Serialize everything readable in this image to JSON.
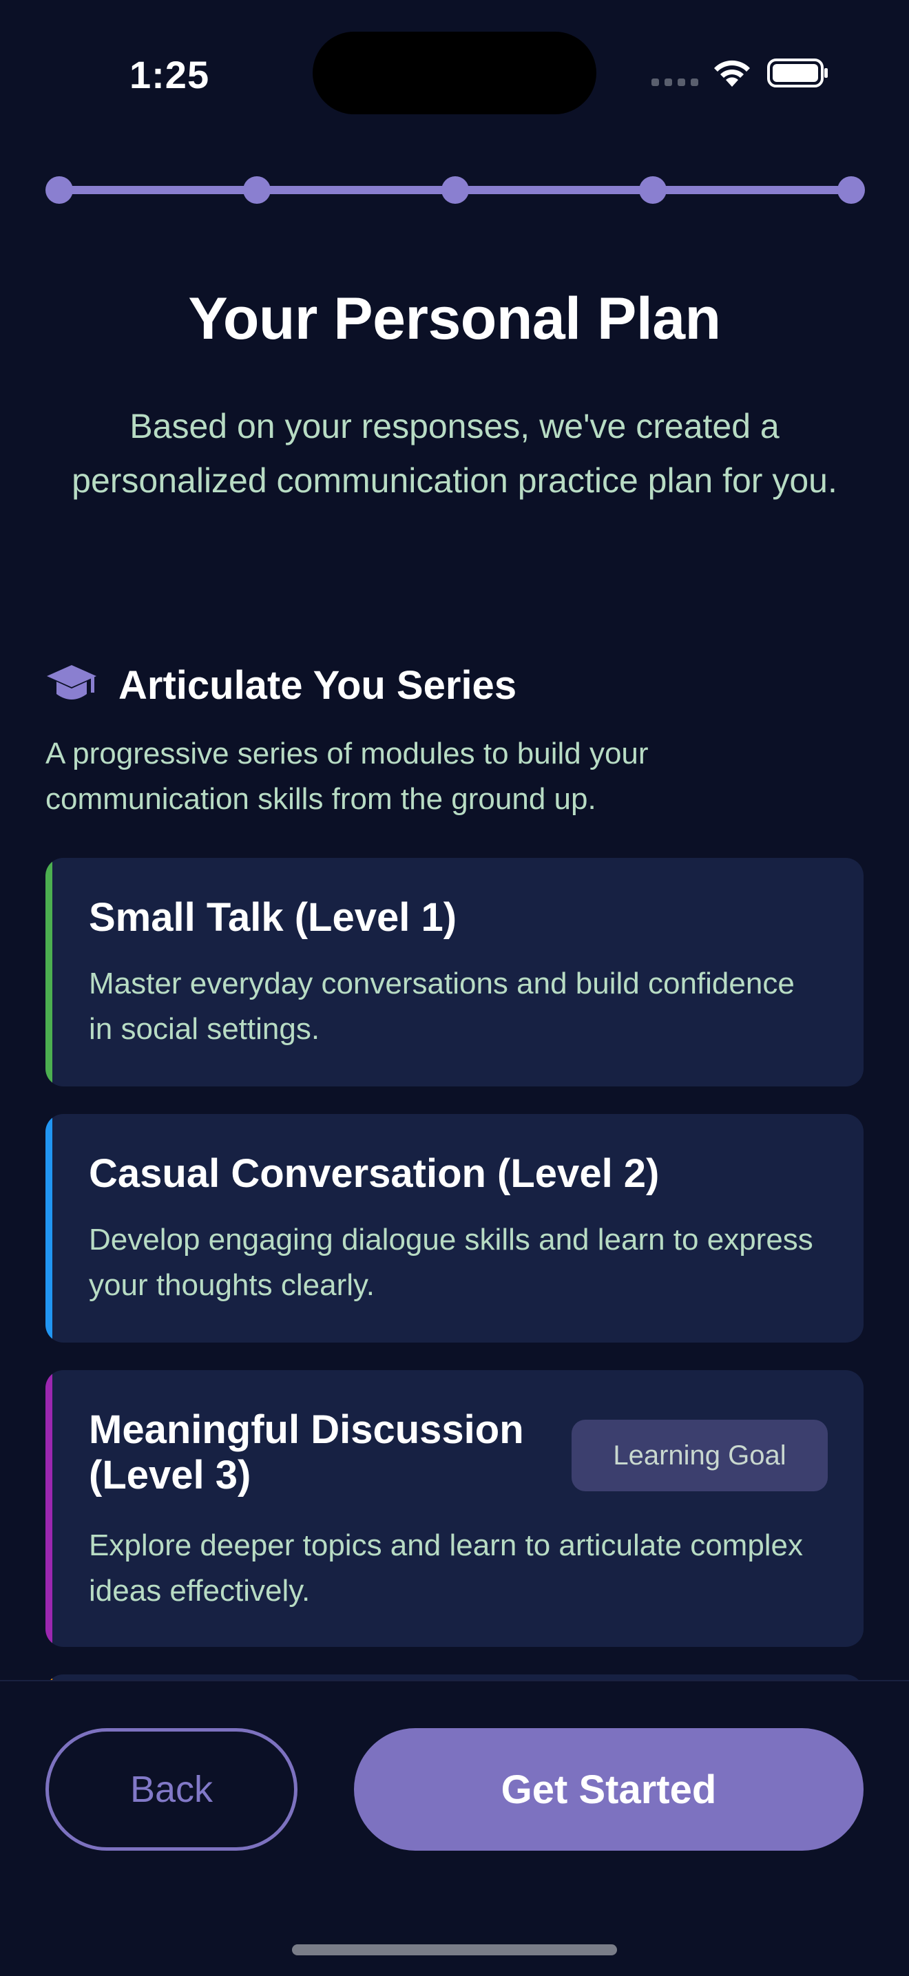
{
  "status_bar": {
    "time": "1:25"
  },
  "progress": {
    "steps": 5,
    "current_step": 5
  },
  "header": {
    "title": "Your Personal Plan",
    "subtitle": "Based on your responses, we've created a personalized communication practice plan for you."
  },
  "series": {
    "icon": "graduation-cap-icon",
    "title": "Articulate You Series",
    "description": "A progressive series of modules to build your communication skills from the ground up."
  },
  "modules": [
    {
      "title": "Small Talk (Level 1)",
      "description": "Master everyday conversations and build confidence in social settings.",
      "accent_color": "#4caf50"
    },
    {
      "title": "Casual Conversation (Level 2)",
      "description": "Develop engaging dialogue skills and learn to express your thoughts clearly.",
      "accent_color": "#2196f3"
    },
    {
      "title": "Meaningful Discussion (Level 3)",
      "description": "Explore deeper topics and learn to articulate complex ideas effectively.",
      "accent_color": "#9c27b0",
      "badge": "Learning Goal"
    }
  ],
  "actions": {
    "back_label": "Back",
    "start_label": "Get Started"
  },
  "colors": {
    "background": "#0b1026",
    "card": "#172143",
    "primary": "#7d72c0",
    "muted_text": "#b8dcc4"
  }
}
